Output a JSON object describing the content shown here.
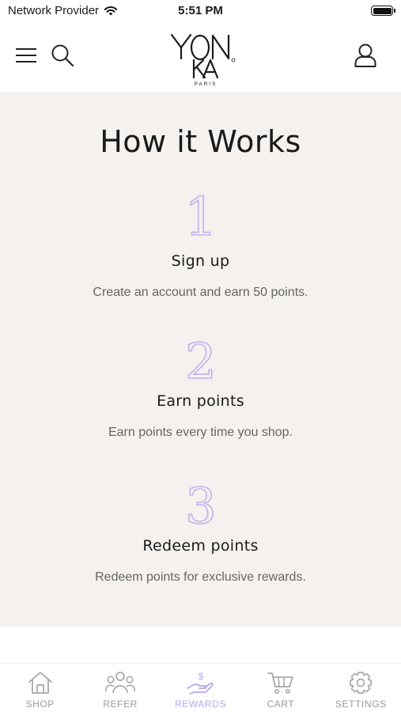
{
  "status_bar": {
    "carrier": "Network Provider",
    "time": "5:51 PM"
  },
  "header": {
    "logo_text": "YONKA",
    "logo_subtext": "PARIS"
  },
  "main": {
    "title": "How it Works",
    "steps": [
      {
        "number": "1",
        "title": "Sign up",
        "description": "Create an account and earn 50 points."
      },
      {
        "number": "2",
        "title": "Earn points",
        "description": "Earn points every time you shop."
      },
      {
        "number": "3",
        "title": "Redeem points",
        "description": "Redeem points for exclusive rewards."
      }
    ]
  },
  "bottom_nav": {
    "items": [
      {
        "label": "SHOP",
        "icon": "home-icon"
      },
      {
        "label": "REFER",
        "icon": "people-icon"
      },
      {
        "label": "REWARDS",
        "icon": "rewards-icon",
        "active": true
      },
      {
        "label": "CART",
        "icon": "cart-icon"
      },
      {
        "label": "SETTINGS",
        "icon": "gear-icon"
      }
    ]
  },
  "colors": {
    "accent": "#b7a7ee",
    "content_background": "#f4f1ee",
    "inactive_nav": "#999999"
  }
}
